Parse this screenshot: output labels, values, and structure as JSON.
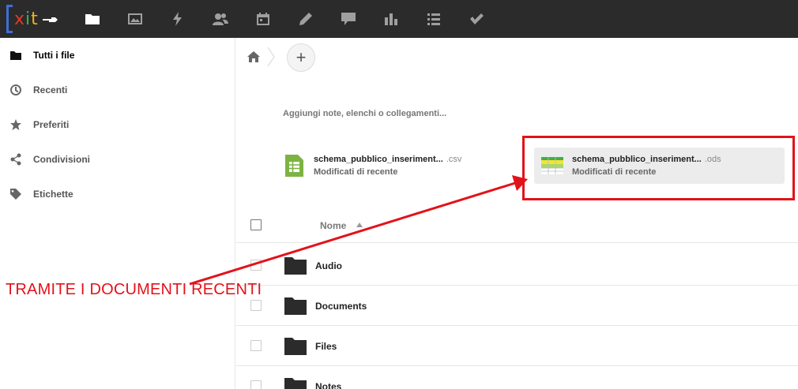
{
  "header": {
    "logo_text": "xit",
    "icons": [
      "files-icon",
      "gallery-icon",
      "activity-icon",
      "contacts-icon",
      "calendar-icon",
      "notes-icon",
      "chat-icon",
      "charts-icon",
      "tasks-icon",
      "checkmark-icon"
    ],
    "active_index": 0
  },
  "sidebar": {
    "items": [
      {
        "label": "Tutti i file",
        "icon": "folder-icon",
        "active": true
      },
      {
        "label": "Recenti",
        "icon": "clock-icon",
        "active": false
      },
      {
        "label": "Preferiti",
        "icon": "star-icon",
        "active": false
      },
      {
        "label": "Condivisioni",
        "icon": "share-icon",
        "active": false
      },
      {
        "label": "Etichette",
        "icon": "tag-icon",
        "active": false
      }
    ]
  },
  "main": {
    "add_label": "+",
    "notes_placeholder": "Aggiungi note, elenchi o collegamenti...",
    "recent": [
      {
        "name": "schema_pubblico_inseriment...",
        "ext": ".csv",
        "sub": "Modificati di recente",
        "icon": "spreadsheet-csv-icon"
      },
      {
        "name": "schema_pubblico_inseriment...",
        "ext": ".ods",
        "sub": "Modificati di recente",
        "icon": "spreadsheet-ods-icon"
      }
    ],
    "table": {
      "column_name": "Nome",
      "rows": [
        "Audio",
        "Documents",
        "Files",
        "Notes"
      ]
    }
  },
  "annotation": {
    "text": "TRAMITE I DOCUMENTI RECENTI",
    "color": "#e3121a"
  }
}
